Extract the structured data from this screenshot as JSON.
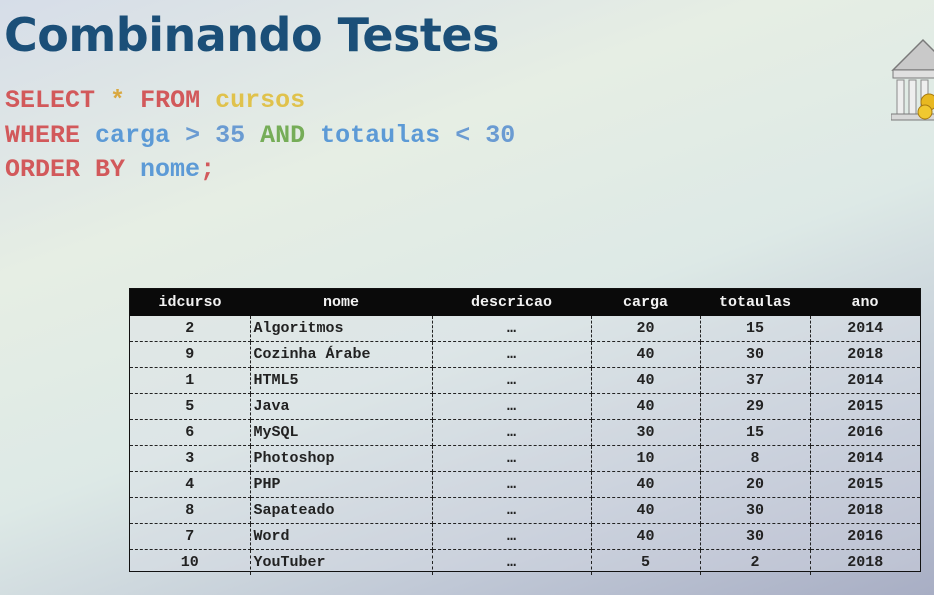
{
  "title": "Combinando Testes",
  "sql": {
    "line1": {
      "kw1": "SELECT",
      "star": "*",
      "kw2": "FROM",
      "table": "cursos"
    },
    "line2": {
      "kw": "WHERE",
      "col1": "carga",
      "op1": ">",
      "val1": "35",
      "and": "AND",
      "col2": "totaulas",
      "op2": "<",
      "val2": "30"
    },
    "line3": {
      "kw": "ORDER BY",
      "col": "nome",
      "end": ";"
    }
  },
  "table": {
    "headers": [
      "idcurso",
      "nome",
      "descricao",
      "carga",
      "totaulas",
      "ano"
    ],
    "rows": [
      [
        "2",
        "Algoritmos",
        "…",
        "20",
        "15",
        "2014"
      ],
      [
        "9",
        "Cozinha Árabe",
        "…",
        "40",
        "30",
        "2018"
      ],
      [
        "1",
        "HTML5",
        "…",
        "40",
        "37",
        "2014"
      ],
      [
        "5",
        "Java",
        "…",
        "40",
        "29",
        "2015"
      ],
      [
        "6",
        "MySQL",
        "…",
        "30",
        "15",
        "2016"
      ],
      [
        "3",
        "Photoshop",
        "…",
        "10",
        "8",
        "2014"
      ],
      [
        "4",
        "PHP",
        "…",
        "40",
        "20",
        "2015"
      ],
      [
        "8",
        "Sapateado",
        "…",
        "40",
        "30",
        "2018"
      ],
      [
        "7",
        "Word",
        "…",
        "40",
        "30",
        "2016"
      ],
      [
        "10",
        "YouTuber",
        "…",
        "5",
        "2",
        "2018"
      ]
    ]
  },
  "icons": {
    "corner": "bank-building-icon"
  },
  "colors": {
    "title": "#1b4f78",
    "keyword": "#d2595b",
    "table_name": "#e0c24c",
    "column": "#5c9ad6",
    "and": "#76ad58"
  }
}
